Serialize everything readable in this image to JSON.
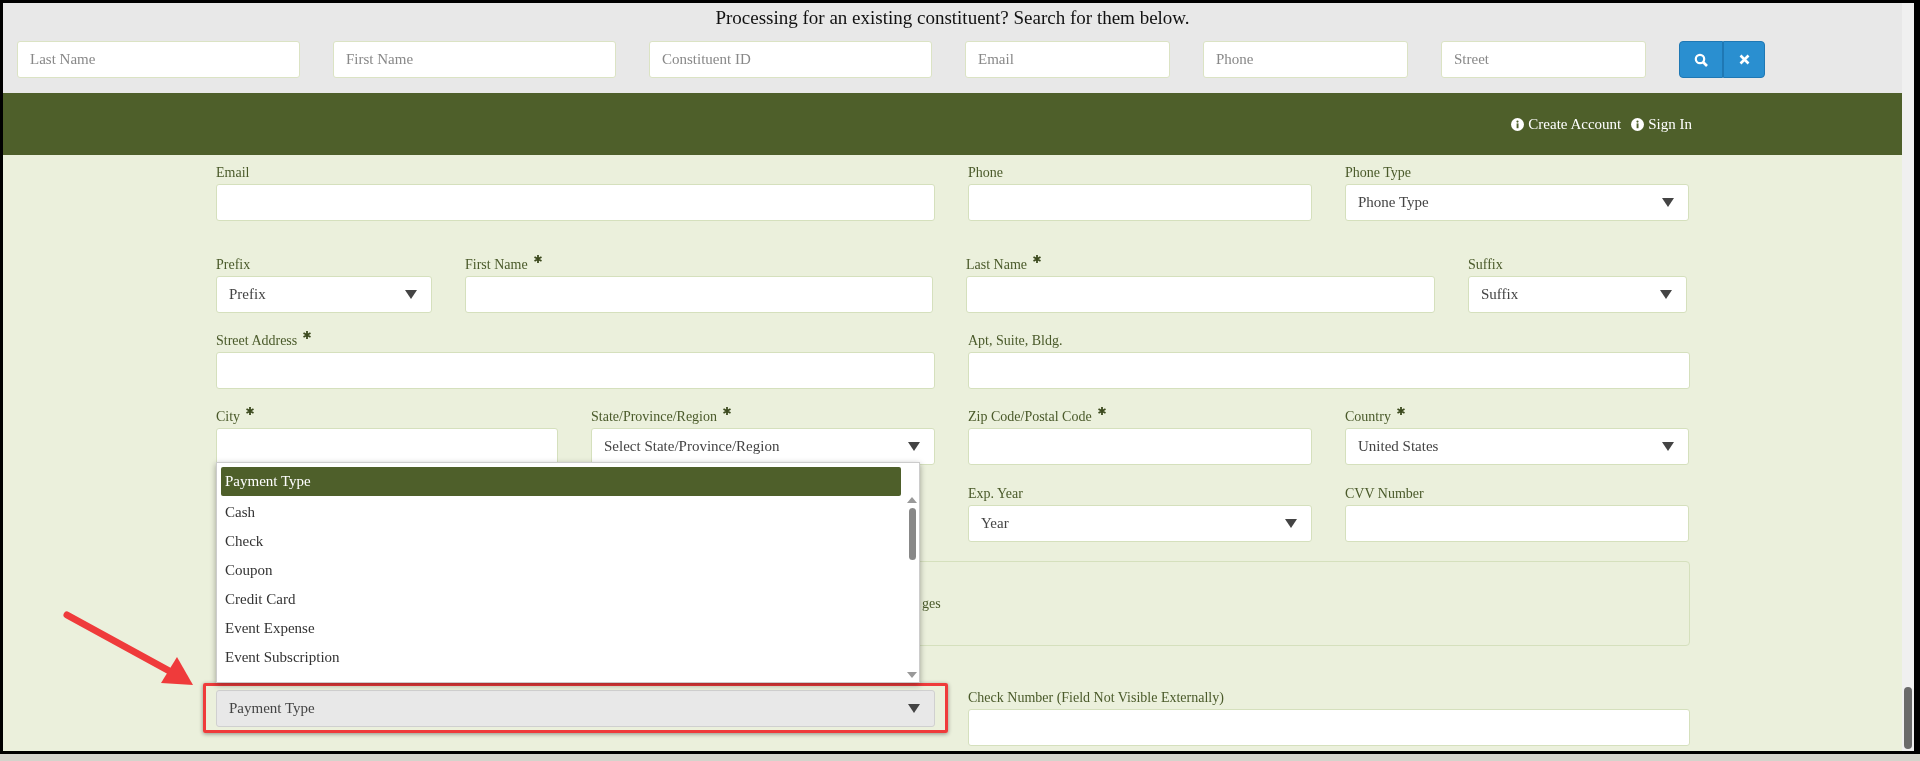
{
  "search": {
    "title": "Processing for an existing constituent? Search for them below.",
    "fields": [
      {
        "placeholder": "Last Name"
      },
      {
        "placeholder": "First Name"
      },
      {
        "placeholder": "Constituent ID"
      },
      {
        "placeholder": "Email"
      },
      {
        "placeholder": "Phone"
      },
      {
        "placeholder": "Street"
      }
    ]
  },
  "nav": {
    "links": [
      {
        "label": "Create Account"
      },
      {
        "label": "Sign In"
      }
    ]
  },
  "form": {
    "rows": [
      [
        {
          "label": "Email",
          "required": false,
          "kind": "input"
        },
        "",
        {
          "label": "Phone",
          "required": false,
          "kind": "input"
        },
        {
          "label": "Phone Type",
          "required": false,
          "kind": "select",
          "value": "Phone Type"
        }
      ],
      [
        {
          "label": "Prefix",
          "required": false,
          "kind": "select",
          "value": "Prefix"
        },
        {
          "label": "First Name",
          "required": true,
          "kind": "input"
        },
        {
          "label": "Last Name",
          "required": true,
          "kind": "input"
        },
        {
          "label": "Suffix",
          "required": false,
          "kind": "select",
          "value": "Suffix"
        }
      ],
      [
        {
          "label": "Street Address",
          "required": true,
          "kind": "input"
        },
        "",
        {
          "label": "Apt, Suite, Bldg.",
          "required": false,
          "kind": "input"
        }
      ],
      [
        {
          "label": "City",
          "required": true,
          "kind": "input"
        },
        {
          "label": "State/Province/Region",
          "required": true,
          "kind": "select",
          "value": "Select State/Province/Region"
        },
        {
          "label": "Zip Code/Postal Code",
          "required": true,
          "kind": "input"
        },
        {
          "label": "Country",
          "required": true,
          "kind": "select",
          "value": "United States"
        }
      ],
      [
        "",
        "",
        {
          "label": "Exp. Year",
          "required": false,
          "kind": "select",
          "value": "Year"
        },
        {
          "label": "CVV Number",
          "required": false,
          "kind": "input"
        }
      ]
    ],
    "notice": "ges",
    "payment": {
      "value": "Payment Type",
      "highlighted": true
    },
    "check_number": {
      "label": "Check Number (Field Not Visible Externally)",
      "required": false,
      "kind": "input"
    }
  },
  "dropdown": {
    "options": [
      {
        "label": "Payment Type",
        "selected": true
      },
      {
        "label": "Cash",
        "selected": false
      },
      {
        "label": "Check",
        "selected": false
      },
      {
        "label": "Coupon",
        "selected": false
      },
      {
        "label": "Credit Card",
        "selected": false
      },
      {
        "label": "Event Expense",
        "selected": false
      },
      {
        "label": "Event Subscription",
        "selected": false
      }
    ]
  }
}
